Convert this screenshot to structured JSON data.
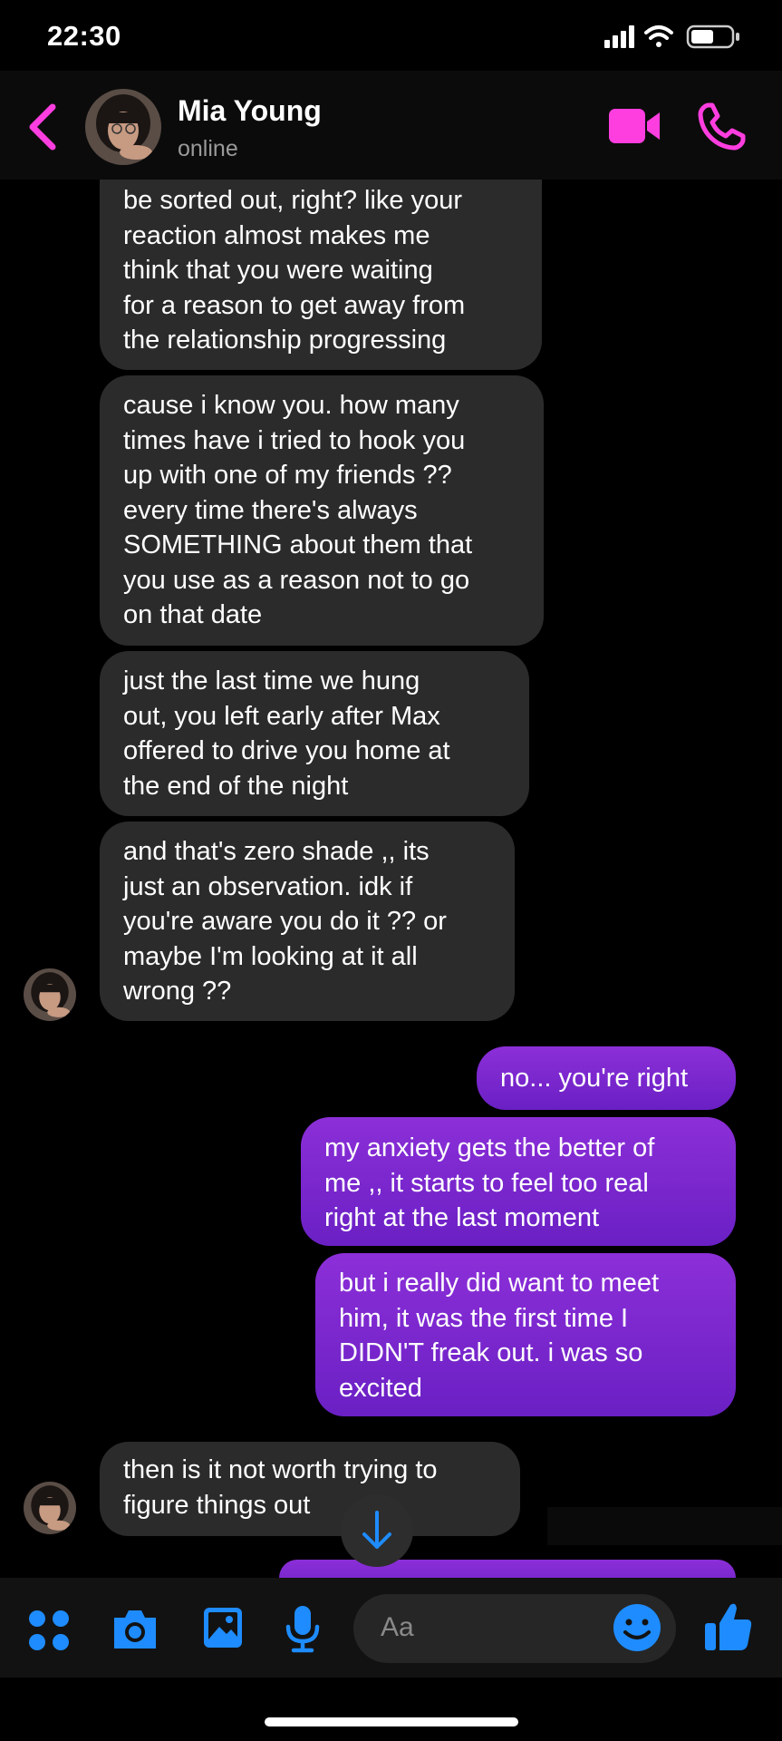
{
  "status_bar": {
    "time": "22:30"
  },
  "header": {
    "name": "Mia Young",
    "status": "online"
  },
  "messages": [
    {
      "direction": "in",
      "lines": [
        "be sorted out, right? like your",
        "reaction almost makes me",
        "think that you were waiting",
        "for a reason to get away from",
        "the relationship progressing"
      ]
    },
    {
      "direction": "in",
      "lines": [
        "cause i know you. how many",
        "times have i tried to hook you",
        "up with one of my friends ??",
        "every time there's always",
        "SOMETHING about them that",
        "you use as a reason not to go",
        "on that date"
      ]
    },
    {
      "direction": "in",
      "lines": [
        "just the last time we hung",
        "out, you left early after Max",
        "offered to drive you home at",
        "the end of the night"
      ]
    },
    {
      "direction": "in",
      "lines": [
        "and that's zero shade ,, its",
        "just an observation. idk if",
        "you're aware you do it ?? or",
        "maybe I'm looking at it all",
        "wrong ??"
      ]
    },
    {
      "direction": "out",
      "lines": [
        "no... you're right"
      ]
    },
    {
      "direction": "out",
      "lines": [
        "my anxiety gets the better of",
        "me ,, it starts to feel too real",
        "right at the last moment"
      ]
    },
    {
      "direction": "out",
      "lines": [
        "but i really did want to meet",
        "him, it was the first time I",
        "DIDN'T freak out. i was so",
        "excited"
      ]
    },
    {
      "direction": "in",
      "lines": [
        "then is it not worth trying to",
        "figure things out"
      ]
    }
  ],
  "composer": {
    "placeholder": "Aa"
  },
  "colors": {
    "accent": "#ff3ee0",
    "outgoing": "#7b27cf",
    "incoming": "#2b2b2b",
    "toolbar_blue": "#1e8cff"
  },
  "icons": [
    "back-chevron-icon",
    "video-camera-icon",
    "phone-icon",
    "apps-icon",
    "camera-icon",
    "image-icon",
    "microphone-icon",
    "emoji-icon",
    "thumbs-up-icon",
    "arrow-down-icon"
  ]
}
